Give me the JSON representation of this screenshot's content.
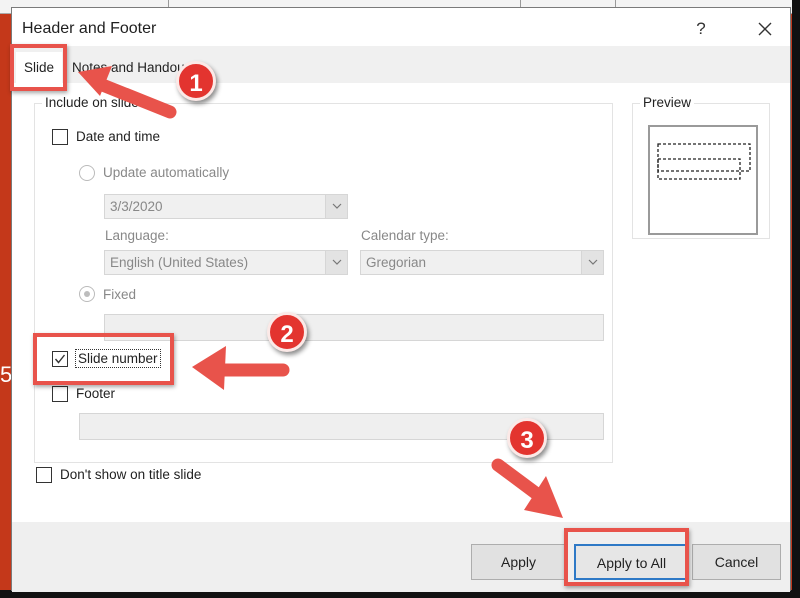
{
  "dialog": {
    "title": "Header and Footer",
    "help_label": "?",
    "close_label": "✕",
    "tabs": [
      {
        "label": "Slide",
        "active": true
      },
      {
        "label": "Notes and Handouts",
        "visible_label": "Notes and Handou",
        "active": false
      }
    ],
    "include_group": {
      "legend": "Include on slide",
      "date_time": {
        "label": "Date and time",
        "checked": false
      },
      "update_automatically": {
        "label": "Update automatically",
        "selected": false
      },
      "date_combo": {
        "value": "3/3/2020"
      },
      "language": {
        "label": "Language:",
        "value": "English (United States)"
      },
      "calendar_type": {
        "label": "Calendar type:",
        "value": "Gregorian"
      },
      "fixed": {
        "label": "Fixed",
        "selected": true,
        "value": ""
      },
      "slide_number": {
        "label": "Slide number",
        "checked": true
      },
      "footer": {
        "label": "Footer",
        "checked": false,
        "value": ""
      }
    },
    "dont_show_title": {
      "label": "Don't show on title slide",
      "checked": false
    },
    "preview": {
      "legend": "Preview"
    },
    "buttons": {
      "apply": "Apply",
      "apply_to_all": "Apply to All",
      "cancel": "Cancel"
    }
  },
  "annotations": {
    "steps": [
      "1",
      "2",
      "3"
    ],
    "color": "#e8534b"
  },
  "background": {
    "accent": "#c4381a",
    "glyph": "5"
  }
}
